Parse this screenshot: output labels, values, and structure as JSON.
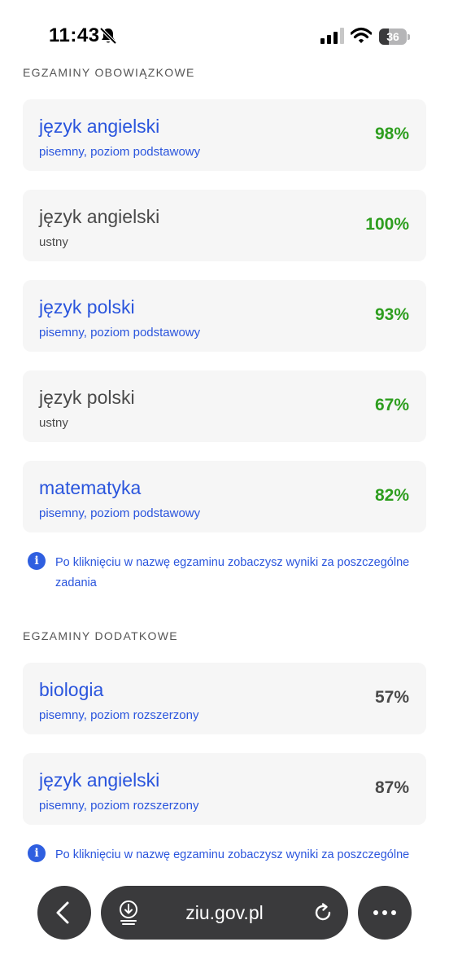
{
  "status_bar": {
    "time": "11:43",
    "battery_percent": 36,
    "battery_text": "36"
  },
  "sections": {
    "mandatory": {
      "title": "EGZAMINY OBOWIĄZKOWE",
      "exams": [
        {
          "name": "język angielski",
          "detail": "pisemny, poziom podstawowy",
          "score": "98%",
          "linked": true
        },
        {
          "name": "język angielski",
          "detail": "ustny",
          "score": "100%",
          "linked": false
        },
        {
          "name": "język polski",
          "detail": "pisemny, poziom podstawowy",
          "score": "93%",
          "linked": true
        },
        {
          "name": "język polski",
          "detail": "ustny",
          "score": "67%",
          "linked": false
        },
        {
          "name": "matematyka",
          "detail": "pisemny, poziom podstawowy",
          "score": "82%",
          "linked": true
        }
      ],
      "info": "Po kliknięciu w nazwę egzaminu zobaczysz wyniki za poszczególne zadania"
    },
    "additional": {
      "title": "EGZAMINY DODATKOWE",
      "exams": [
        {
          "name": "biologia",
          "detail": "pisemny, poziom rozszerzony",
          "score": "57%",
          "linked": true
        },
        {
          "name": "język angielski",
          "detail": "pisemny, poziom rozszerzony",
          "score": "87%",
          "linked": true
        }
      ],
      "info": "Po kliknięciu w nazwę egzaminu zobaczysz wyniki za poszczególne"
    }
  },
  "browser_bar": {
    "url": "ziu.gov.pl"
  },
  "icons": {
    "bell": "bell-slash-icon",
    "signal": "cellular-signal-icon",
    "wifi": "wifi-icon",
    "info": "info-icon",
    "back": "chevron-left-icon",
    "download": "download-icon",
    "reload": "reload-icon",
    "more": "ellipsis-icon"
  },
  "colors": {
    "link_blue": "#2a55dd",
    "score_green": "#2e9e1f",
    "score_gray": "#4a4a4a",
    "card_bg": "#f6f6f6",
    "pill_bg": "#3a3a3c"
  }
}
